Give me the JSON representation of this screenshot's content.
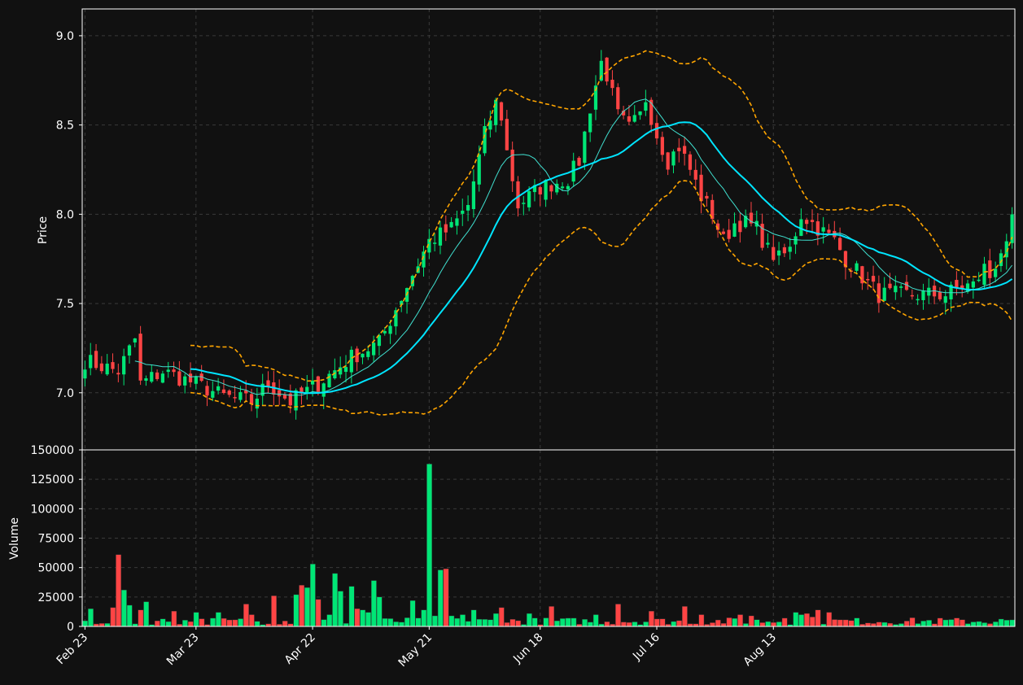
{
  "chart_data": {
    "type": "candlestick",
    "x_tick_labels": [
      "Feb 23",
      "Mar 23",
      "Apr 22",
      "May 21",
      "Jun 18",
      "Jul 16",
      "Aug 13"
    ],
    "price_panel": {
      "ylabel": "Price",
      "ylim": [
        6.68,
        9.15
      ],
      "yticks": [
        7.0,
        7.5,
        8.0,
        8.5,
        9.0
      ],
      "grid": true
    },
    "volume_panel": {
      "ylabel": "Volume",
      "ylim": [
        0,
        150000
      ],
      "yticks": [
        0,
        25000,
        50000,
        75000,
        100000,
        125000,
        150000
      ],
      "grid": true
    },
    "colors": {
      "background": "#111111",
      "up": "#00e676",
      "down": "#ff4444",
      "ma_fast": "#40e0d0",
      "ma_slow": "#00e5ff",
      "bollinger": "#ffa500",
      "grid": "#3a3a3a"
    },
    "close_anchors": [
      [
        0,
        7.18
      ],
      [
        6,
        7.12
      ],
      [
        9,
        7.3
      ],
      [
        10,
        7.05
      ],
      [
        14,
        7.12
      ],
      [
        20,
        7.05
      ],
      [
        25,
        6.98
      ],
      [
        30,
        6.95
      ],
      [
        33,
        7.05
      ],
      [
        37,
        6.95
      ],
      [
        42,
        7.05
      ],
      [
        48,
        7.2
      ],
      [
        53,
        7.28
      ],
      [
        58,
        7.6
      ],
      [
        62,
        7.85
      ],
      [
        66,
        7.92
      ],
      [
        69,
        8.05
      ],
      [
        72,
        8.45
      ],
      [
        74,
        8.62
      ],
      [
        75,
        8.55
      ],
      [
        76,
        8.35
      ],
      [
        78,
        8.05
      ],
      [
        82,
        8.15
      ],
      [
        87,
        8.2
      ],
      [
        89,
        8.3
      ],
      [
        91,
        8.6
      ],
      [
        93,
        8.85
      ],
      [
        94,
        8.78
      ],
      [
        96,
        8.55
      ],
      [
        98,
        8.48
      ],
      [
        100,
        8.55
      ],
      [
        101,
        8.65
      ],
      [
        103,
        8.45
      ],
      [
        105,
        8.3
      ],
      [
        107,
        8.38
      ],
      [
        109,
        8.25
      ],
      [
        111,
        8.1
      ],
      [
        113,
        8.0
      ],
      [
        115,
        7.85
      ],
      [
        117,
        7.95
      ],
      [
        119,
        7.95
      ],
      [
        121,
        7.92
      ],
      [
        123,
        7.8
      ],
      [
        125,
        7.75
      ],
      [
        127,
        7.8
      ],
      [
        129,
        8.0
      ],
      [
        131,
        7.95
      ],
      [
        133,
        7.9
      ],
      [
        135,
        7.85
      ],
      [
        137,
        7.75
      ],
      [
        140,
        7.65
      ],
      [
        143,
        7.55
      ],
      [
        146,
        7.55
      ],
      [
        149,
        7.55
      ],
      [
        152,
        7.55
      ],
      [
        155,
        7.55
      ],
      [
        158,
        7.6
      ],
      [
        160,
        7.6
      ],
      [
        162,
        7.7
      ],
      [
        163,
        7.65
      ],
      [
        165,
        7.8
      ],
      [
        166,
        7.8
      ],
      [
        167,
        7.95
      ]
    ],
    "volume_spikes": [
      [
        1,
        15000
      ],
      [
        5,
        16000
      ],
      [
        6,
        61000
      ],
      [
        7,
        31000
      ],
      [
        8,
        18000
      ],
      [
        10,
        14000
      ],
      [
        11,
        21000
      ],
      [
        16,
        13000
      ],
      [
        20,
        12000
      ],
      [
        24,
        12000
      ],
      [
        29,
        19000
      ],
      [
        30,
        10000
      ],
      [
        34,
        26000
      ],
      [
        38,
        27000
      ],
      [
        39,
        35000
      ],
      [
        40,
        33000
      ],
      [
        41,
        53000
      ],
      [
        42,
        23000
      ],
      [
        44,
        10000
      ],
      [
        45,
        45000
      ],
      [
        46,
        30000
      ],
      [
        48,
        34000
      ],
      [
        49,
        15000
      ],
      [
        50,
        14000
      ],
      [
        51,
        12000
      ],
      [
        52,
        39000
      ],
      [
        53,
        25000
      ],
      [
        59,
        22000
      ],
      [
        61,
        14000
      ],
      [
        62,
        138000
      ],
      [
        63,
        9000
      ],
      [
        64,
        48000
      ],
      [
        65,
        49000
      ],
      [
        66,
        9000
      ],
      [
        68,
        10000
      ],
      [
        70,
        14000
      ],
      [
        74,
        11000
      ],
      [
        75,
        16000
      ],
      [
        80,
        11000
      ],
      [
        84,
        17000
      ],
      [
        92,
        10000
      ],
      [
        96,
        19000
      ],
      [
        102,
        13000
      ],
      [
        108,
        17000
      ],
      [
        111,
        10000
      ],
      [
        118,
        10000
      ],
      [
        120,
        9000
      ],
      [
        126,
        7000
      ],
      [
        128,
        12000
      ],
      [
        129,
        10000
      ],
      [
        130,
        11000
      ],
      [
        131,
        8000
      ],
      [
        132,
        14000
      ],
      [
        134,
        12000
      ]
    ],
    "notes": "OHLC candles with 10- and 20-period moving averages and Bollinger bands; volume bars colored by candle direction."
  },
  "labels": {
    "price_axis": "Price",
    "volume_axis": "Volume"
  }
}
